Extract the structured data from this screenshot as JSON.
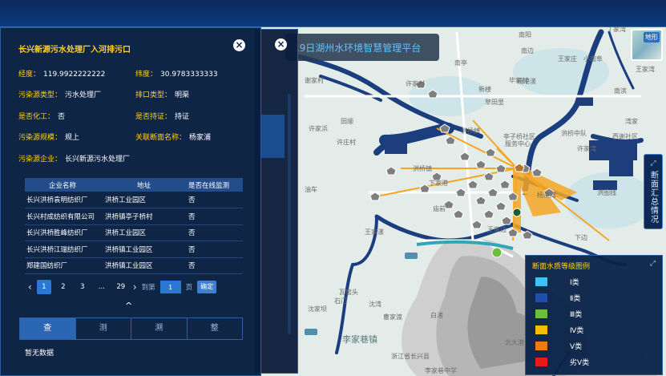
{
  "header": {
    "platform_title": "19日湖州水环境智慧管理平台",
    "basemap_label": "地形"
  },
  "side_tab": {
    "label": "断面汇总情况"
  },
  "detail": {
    "title": "长兴新源污水处理厂入河排污口",
    "fields": [
      {
        "key": "经度：",
        "value": "119.9922222222"
      },
      {
        "key": "纬度：",
        "value": "30.9783333333"
      },
      {
        "key": "污染源类型：",
        "value": "污水处理厂"
      },
      {
        "key": "排口类型：",
        "value": "明渠"
      },
      {
        "key": "是否化工：",
        "value": "否"
      },
      {
        "key": "是否持证：",
        "value": "持证"
      },
      {
        "key": "污染源规模：",
        "value": "规上"
      },
      {
        "key": "关联断面名称：",
        "value": "杨家浦"
      },
      {
        "key": "污染源企业：",
        "value": "长兴新源污水处理厂"
      }
    ],
    "table": {
      "headers": [
        "企业名称",
        "地址",
        "是否在线监测"
      ],
      "rows": [
        [
          "长兴洪桥袁明纺织厂",
          "洪桥工业园区",
          "否"
        ],
        [
          "长兴村成纺织有限公司",
          "洪桥镇亭子桥村",
          "否"
        ],
        [
          "长兴洪桥胜峰纺织厂",
          "洪桥工业园区",
          "否"
        ],
        [
          "长兴洪桥江瑞纺织厂",
          "洪桥镇工业园区",
          "否"
        ],
        [
          "郑建国纺织厂",
          "洪桥镇工业园区",
          "否"
        ]
      ]
    },
    "pagination": {
      "prev": "‹",
      "next": "›",
      "pages": [
        "1",
        "2",
        "3",
        "...",
        "29"
      ],
      "current": "1",
      "goto_label": "到第",
      "goto_value": "1",
      "page_unit": "页",
      "confirm": "确定"
    },
    "collapse_icon": "^",
    "tabs": [
      "查",
      "测",
      "溯",
      "整"
    ],
    "active_tab": "查",
    "empty_text": "暂无数据"
  },
  "legend": {
    "title": "断面水质等级图例",
    "items": [
      {
        "label": "Ⅰ类",
        "color": "#3fc3f7"
      },
      {
        "label": "Ⅱ类",
        "color": "#1f4fa8"
      },
      {
        "label": "Ⅲ类",
        "color": "#6cbf3c"
      },
      {
        "label": "Ⅳ类",
        "color": "#f2c000"
      },
      {
        "label": "Ⅴ类",
        "color": "#ee7a12"
      },
      {
        "label": "劣Ⅴ类",
        "color": "#e81a1a"
      }
    ]
  },
  "map_labels": [
    "南阳",
    "丁家湾",
    "南亭",
    "王家庄",
    "南边",
    "小南阜",
    "王家湾",
    "许家村",
    "毕家村",
    "谢家村",
    "新楼",
    "南滨",
    "草田里",
    "洪桥鎮",
    "亭子桥社区",
    "服务中心",
    "洪桥中队",
    "西谢社区",
    "湾家",
    "洪桥镇",
    "杨港湾",
    "田顺",
    "许庄村",
    "许家浜",
    "下家港",
    "油车",
    "王家边",
    "庙前",
    "洪图线",
    "王家漾",
    "下边",
    "北大港",
    "石门",
    "瓦窑头",
    "沈湾",
    "白渚",
    "曹家渡",
    "李家巷镇",
    "浙江省长兴县",
    "李家巷中学",
    "杨港漾",
    "许家湾",
    "沈家坝"
  ]
}
